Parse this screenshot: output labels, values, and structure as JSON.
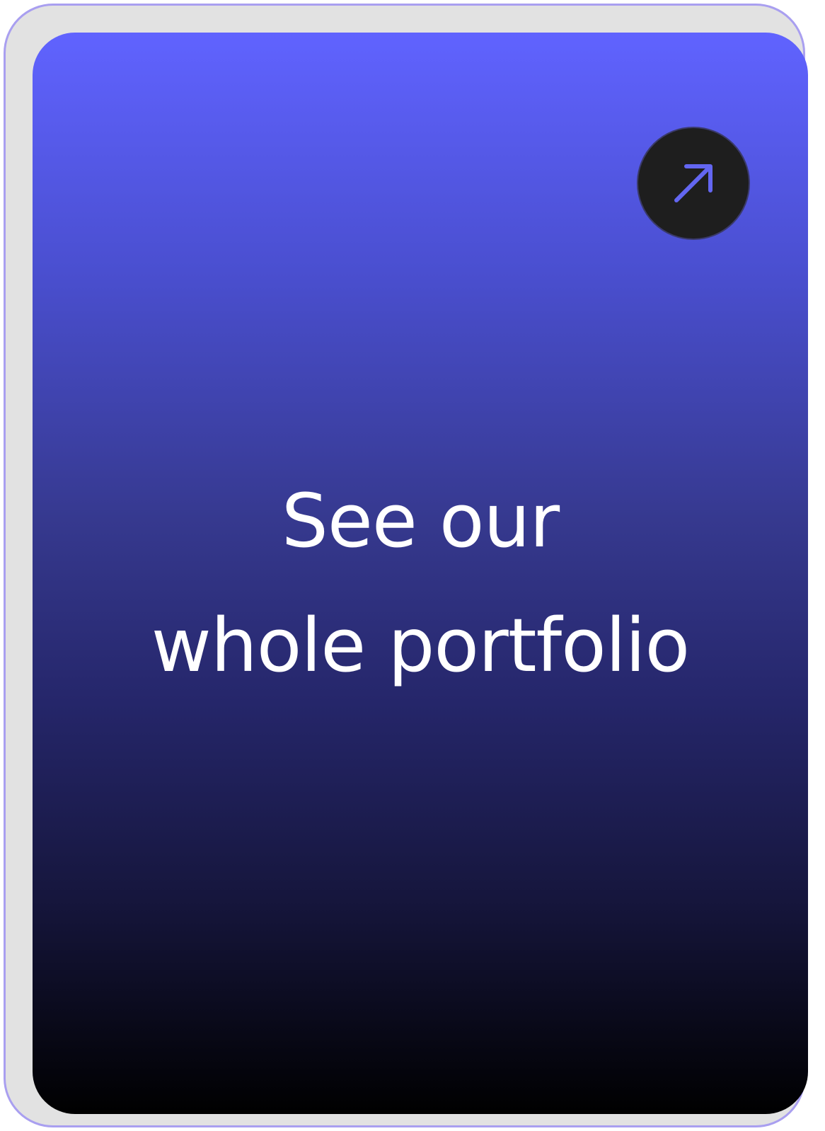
{
  "card": {
    "title_line_1": "See our",
    "title_line_2": "whole portfolio",
    "action_icon": "arrow-up-right-icon"
  },
  "colors": {
    "gradient_top": "#6063ff",
    "gradient_bottom": "#000000",
    "button_background": "#1e1e1e",
    "icon_color": "#6366f1",
    "frame_border": "#a99ff0",
    "frame_background": "#e2e2e2",
    "text": "#ffffff"
  }
}
